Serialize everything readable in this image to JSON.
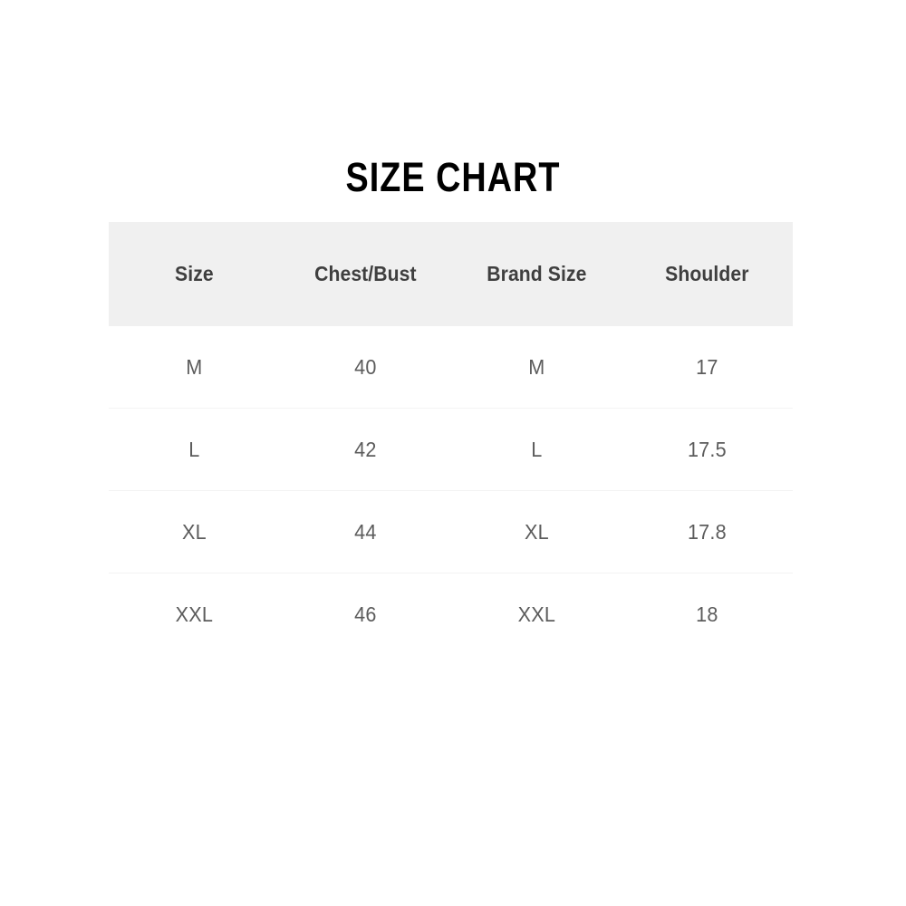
{
  "title": "SIZE CHART",
  "table": {
    "columns": [
      "Size",
      "Chest/Bust",
      "Brand Size",
      "Shoulder"
    ],
    "rows": [
      {
        "size": "M",
        "chest_bust": "40",
        "brand_size": "M",
        "shoulder": "17"
      },
      {
        "size": "L",
        "chest_bust": "42",
        "brand_size": "L",
        "shoulder": "17.5"
      },
      {
        "size": "XL",
        "chest_bust": "44",
        "brand_size": "XL",
        "shoulder": "17.8"
      },
      {
        "size": "XXL",
        "chest_bust": "46",
        "brand_size": "XXL",
        "shoulder": "18"
      }
    ]
  },
  "colors": {
    "page_background": "#ffffff",
    "header_background": "#f0f0f0",
    "header_text": "#3f3f3f",
    "body_text": "#5c5c5c",
    "title_text": "#000000",
    "row_divider": "#f3f3f3"
  },
  "chart_data": {
    "type": "table",
    "title": "SIZE CHART",
    "columns": [
      "Size",
      "Chest/Bust",
      "Brand Size",
      "Shoulder"
    ],
    "rows": [
      [
        "M",
        "40",
        "M",
        "17"
      ],
      [
        "L",
        "42",
        "L",
        "17.5"
      ],
      [
        "XL",
        "44",
        "XL",
        "17.8"
      ],
      [
        "XXL",
        "46",
        "XXL",
        "18"
      ]
    ],
    "xlabel": "",
    "ylabel": "",
    "grid": false,
    "legend": "none"
  }
}
